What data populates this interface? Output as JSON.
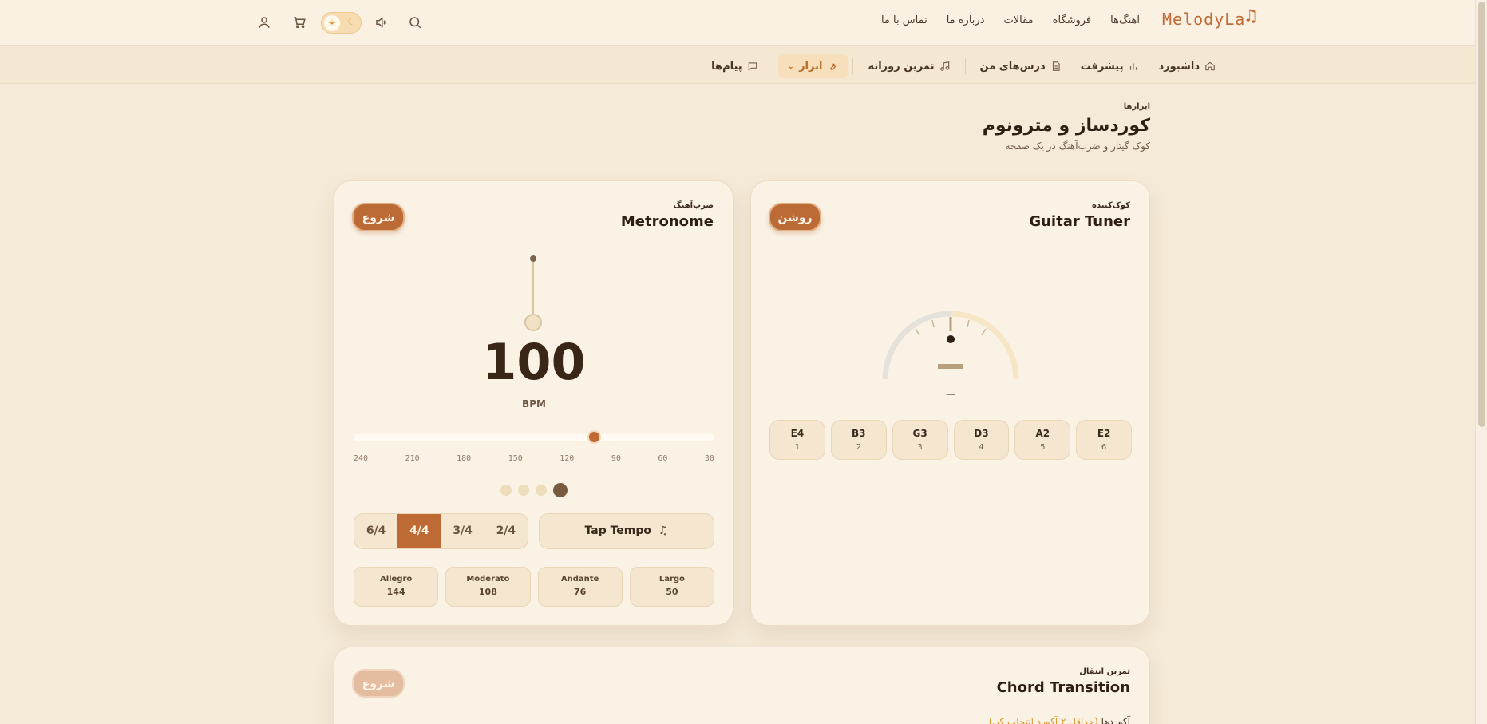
{
  "header": {
    "logo_text": "MelodyLa",
    "nav": [
      {
        "label": "آهنگ‌ها"
      },
      {
        "label": "فروشگاه"
      },
      {
        "label": "مقالات"
      },
      {
        "label": "درباره ما"
      },
      {
        "label": "تماس با ما"
      }
    ]
  },
  "subnav": {
    "items": [
      {
        "label": "داشبورد",
        "icon": "home-icon"
      },
      {
        "label": "پیشرفت",
        "icon": "bar-chart-icon"
      },
      {
        "label": "درس‌های من",
        "icon": "document-icon"
      },
      {
        "label": "تمرین روزانه",
        "icon": "music-note-icon"
      },
      {
        "label": "ابزار",
        "icon": "wrench-icon",
        "active": true
      },
      {
        "label": "پیام‌ها",
        "icon": "message-icon"
      }
    ]
  },
  "page": {
    "breadcrumb": "ابزارها",
    "title": "کوردساز و مترونوم",
    "subtitle": "کوک گیتار و ضرب‌آهنگ در یک صفحه"
  },
  "tuner": {
    "kicker": "کوک‌کننده",
    "title": "Guitar Tuner",
    "button": "روشن",
    "cents": "—",
    "strings": [
      {
        "note": "E2",
        "num": "6"
      },
      {
        "note": "A2",
        "num": "5"
      },
      {
        "note": "D3",
        "num": "4"
      },
      {
        "note": "G3",
        "num": "3"
      },
      {
        "note": "B3",
        "num": "2"
      },
      {
        "note": "E4",
        "num": "1"
      }
    ]
  },
  "metronome": {
    "kicker": "ضرب‌آهنگ",
    "title": "Metronome",
    "button": "شروع",
    "bpm": "100",
    "bpm_label": "BPM",
    "bpm_fraction": 0.667,
    "ticks": [
      "240",
      "210",
      "180",
      "150",
      "120",
      "90",
      "60",
      "30"
    ],
    "beats_count": 4,
    "active_beat": 1,
    "time_signatures": [
      "2/4",
      "3/4",
      "4/4",
      "6/4"
    ],
    "active_time_signature": "4/4",
    "tap_label": "Tap Tempo",
    "presets": [
      {
        "name": "Largo",
        "bpm": "50"
      },
      {
        "name": "Andante",
        "bpm": "76"
      },
      {
        "name": "Moderato",
        "bpm": "108"
      },
      {
        "name": "Allegro",
        "bpm": "144"
      }
    ]
  },
  "chord": {
    "kicker": "تمرین انتقال",
    "title": "Chord Transition",
    "button": "شروع",
    "label_prefix": "آکوردها",
    "label_hint": "(حداقل ۲ آکورد انتخاب کن)"
  },
  "colors": {
    "accent": "#bc6a36",
    "background": "#f5ead8",
    "card": "#fbf2e6"
  }
}
